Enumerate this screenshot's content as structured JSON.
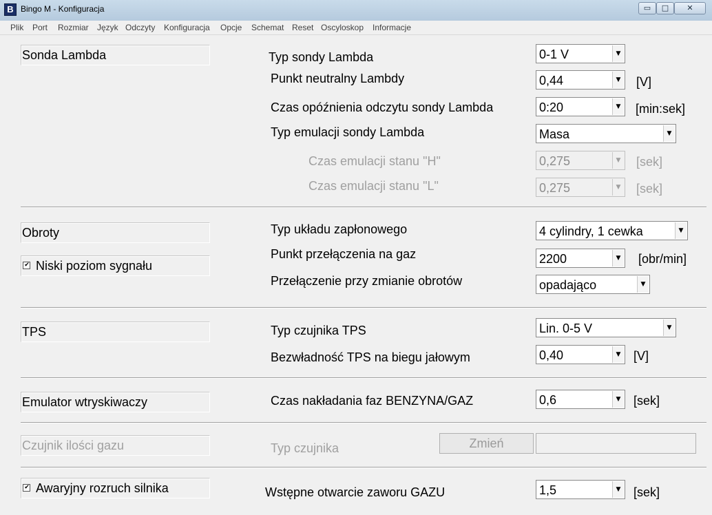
{
  "window": {
    "title": "Bingo M - Konfiguracja",
    "app_icon_letter": "B",
    "minimize_glyph": "▭",
    "maximize_glyph": "□",
    "close_glyph": "✕"
  },
  "menu": [
    "Plik",
    "Port",
    "Rozmiar",
    "Język",
    "Odczyty",
    "Konfiguracja",
    "Opcje",
    "Schemat",
    "Reset",
    "Oscyloskop",
    "Informacje"
  ],
  "sections": {
    "lambda": {
      "group_label": "Sonda Lambda",
      "type_label": "Typ sondy Lambda",
      "type_value": "0-1 V",
      "neutral_label": "Punkt neutralny Lambdy",
      "neutral_value": "0,44",
      "neutral_unit": "[V]",
      "delay_label": "Czas opóźnienia odczytu sondy Lambda",
      "delay_value": "0:20",
      "delay_unit": "[min:sek]",
      "emu_type_label": "Typ emulacji sondy Lambda",
      "emu_type_value": "Masa",
      "h_label": "Czas emulacji stanu \"H\"",
      "h_value": "0,275",
      "h_unit": "[sek]",
      "l_label": "Czas emulacji stanu \"L\"",
      "l_value": "0,275",
      "l_unit": "[sek]"
    },
    "rpm": {
      "group_label": "Obroty",
      "low_signal_label": "Niski poziom sygnału",
      "low_signal_checked": "✔",
      "ignition_label": "Typ układu zapłonowego",
      "ignition_value": "4 cylindry, 1 cewka",
      "switch_point_label": "Punkt przełączenia na gaz",
      "switch_point_value": "2200",
      "switch_point_unit": "[obr/min]",
      "switch_mode_label": "Przełączenie przy zmianie obrotów",
      "switch_mode_value": "opadająco"
    },
    "tps": {
      "group_label": "TPS",
      "sensor_label": "Typ czujnika TPS",
      "sensor_value": "Lin. 0-5 V",
      "idle_label": "Bezwładność TPS na biegu jałowym",
      "idle_value": "0,40",
      "idle_unit": "[V]"
    },
    "injector": {
      "group_label": "Emulator wtryskiwaczy",
      "overlap_label": "Czas nakładania faz BENZYNA/GAZ",
      "overlap_value": "0,6",
      "overlap_unit": "[sek]"
    },
    "gas_sensor": {
      "group_label": "Czujnik ilości gazu",
      "type_label": "Typ czujnika",
      "change_button": "Zmień",
      "field_value": ""
    },
    "emergency": {
      "group_label": "Awaryjny rozruch silnika",
      "checked": "✔",
      "valve_label": "Wstępne otwarcie zaworu GAZU",
      "valve_value": "1,5",
      "valve_unit": "[sek]"
    }
  },
  "dropdown_arrow": "▼"
}
